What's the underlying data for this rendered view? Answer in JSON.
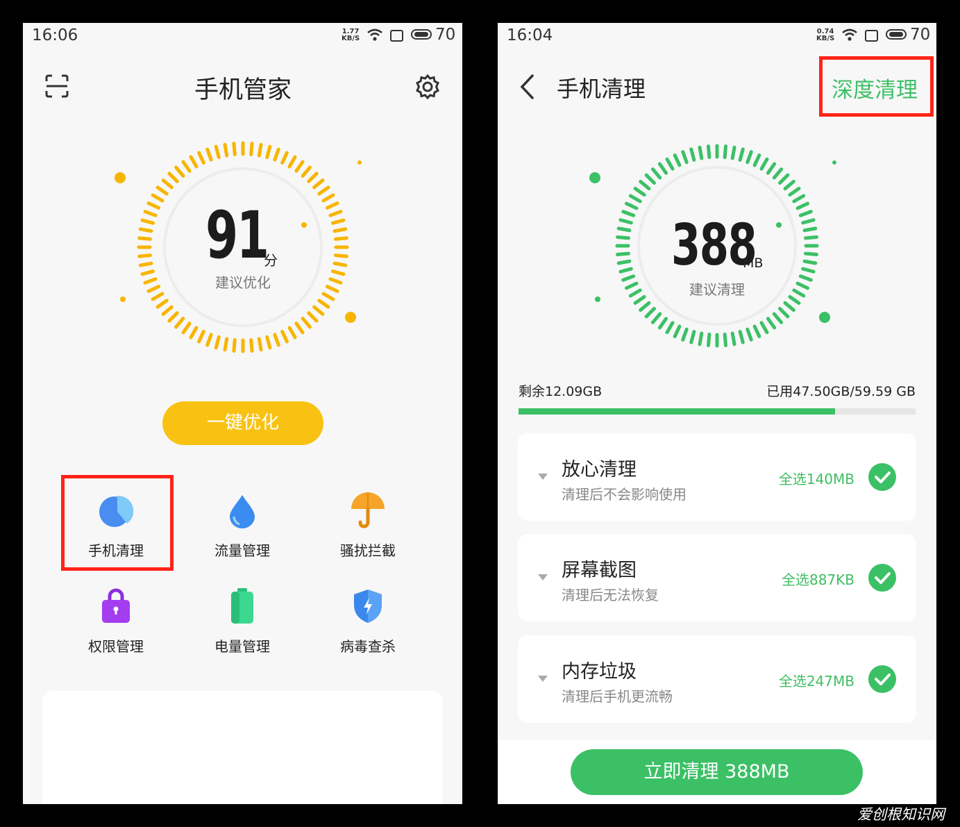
{
  "left_screen": {
    "status": {
      "time": "16:06",
      "speed_value": "1.77",
      "speed_unit": "KB/S",
      "battery_level": "70"
    },
    "header": {
      "title": "手机管家",
      "scan_icon": "scan-icon",
      "settings_icon": "gear-icon"
    },
    "score": {
      "value": "91",
      "unit": "分",
      "caption": "建议优化",
      "accent": "#f7b500"
    },
    "optimize_button": "一键优化",
    "features": [
      {
        "label": "手机清理",
        "icon": "pie-chart-icon"
      },
      {
        "label": "流量管理",
        "icon": "water-drop-icon"
      },
      {
        "label": "骚扰拦截",
        "icon": "umbrella-icon"
      },
      {
        "label": "权限管理",
        "icon": "lock-bag-icon"
      },
      {
        "label": "电量管理",
        "icon": "battery-icon"
      },
      {
        "label": "病毒查杀",
        "icon": "shield-icon"
      }
    ]
  },
  "right_screen": {
    "status": {
      "time": "16:04",
      "speed_value": "0.74",
      "speed_unit": "KB/S",
      "battery_level": "70"
    },
    "header": {
      "title": "手机清理",
      "deep_clean": "深度清理",
      "back_icon": "back-chevron-icon"
    },
    "junk": {
      "value": "388",
      "unit": "MB",
      "caption": "建议清理",
      "accent": "#3cc066"
    },
    "storage": {
      "remaining": "剩余12.09GB",
      "used": "已用47.50GB/59.59 GB",
      "used_fraction": 0.797
    },
    "categories": [
      {
        "title": "放心清理",
        "subtitle": "清理后不会影响使用",
        "select": "全选140MB"
      },
      {
        "title": "屏幕截图",
        "subtitle": "清理后无法恢复",
        "select": "全选887KB"
      },
      {
        "title": "内存垃圾",
        "subtitle": "清理后手机更流畅",
        "select": "全选247MB"
      }
    ],
    "clean_button": "立即清理 388MB"
  },
  "watermark": "爱创根知识网"
}
